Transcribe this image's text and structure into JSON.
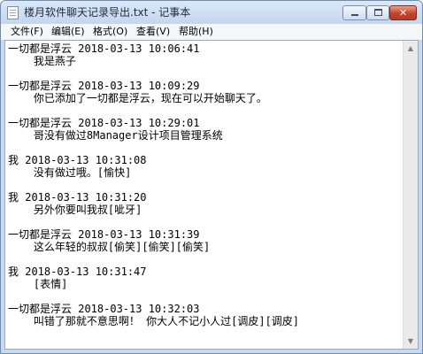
{
  "window": {
    "title": "楼月软件聊天记录导出.txt - 记事本",
    "controls": {
      "minimize": "",
      "maximize": "",
      "close": "✕"
    }
  },
  "menu": [
    {
      "label": "文件(F)"
    },
    {
      "label": "编辑(E)"
    },
    {
      "label": "格式(O)"
    },
    {
      "label": "查看(V)"
    },
    {
      "label": "帮助(H)"
    }
  ],
  "document": {
    "lines": [
      "一切都是浮云 2018-03-13 10:06:41",
      "    我是燕子",
      "",
      "一切都是浮云 2018-03-13 10:09:29",
      "    你已添加了一切都是浮云，现在可以开始聊天了。",
      "",
      "一切都是浮云 2018-03-13 10:29:01",
      "    哥没有做过8Manager设计项目管理系统",
      "",
      "我 2018-03-13 10:31:08",
      "    没有做过哦。[愉快]",
      "",
      "我 2018-03-13 10:31:20",
      "    另外你要叫我叔[呲牙]",
      "",
      "一切都是浮云 2018-03-13 10:31:39",
      "    这么年轻的叔叔[偷笑][偷笑][偷笑]",
      "",
      "我 2018-03-13 10:31:47",
      "    [表情]",
      "",
      "一切都是浮云 2018-03-13 10:32:03",
      "    叫错了那就不意思啊！ 你大人不记小人过[调皮][调皮]"
    ]
  },
  "scrollbar": {
    "up_arrow": "▲",
    "down_arrow": "▼"
  }
}
